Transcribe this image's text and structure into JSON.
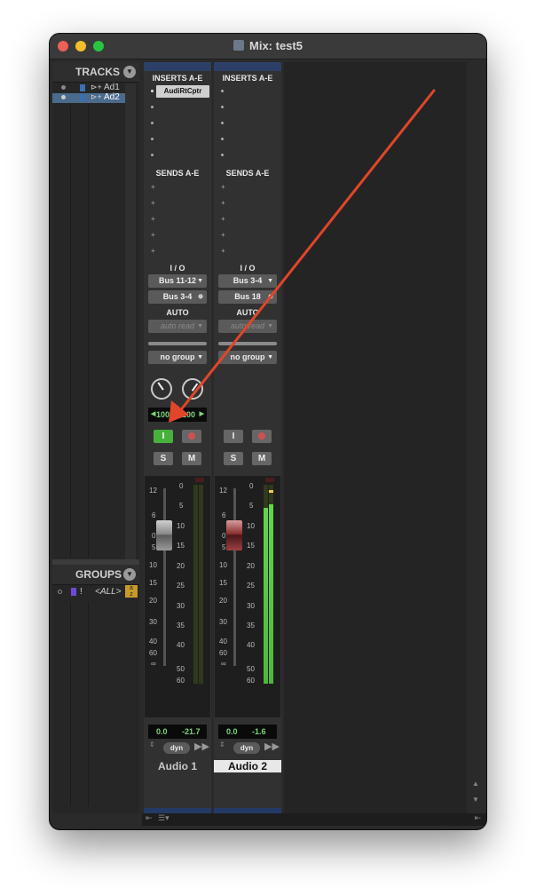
{
  "window": {
    "title": "Mix: test5"
  },
  "colors": {
    "accent_blue": "#3b6fb3",
    "record_red": "#d05050",
    "input_green": "#47b13b",
    "arrow_red": "#e0462a"
  },
  "tracks_panel": {
    "header": "TRACKS",
    "items": [
      {
        "label": "Ad1",
        "selected": false
      },
      {
        "label": "Ad2",
        "selected": true
      }
    ]
  },
  "groups_panel": {
    "header": "GROUPS",
    "items": [
      {
        "label": "<ALL>",
        "flag": "!"
      }
    ],
    "sort_icon": "a-z-sort-icon"
  },
  "strips": [
    {
      "inserts_header": "INSERTS A-E",
      "insert_plugin": "AudiRtCptr",
      "sends_header": "SENDS A-E",
      "io_header": "I / O",
      "input": "Bus 11-12",
      "output": "Bus 3-4",
      "auto_header": "AUTO",
      "auto_mode": "auto read",
      "group": "no group",
      "pan_left": "100",
      "pan_right": "100",
      "input_button": "I",
      "solo": "S",
      "mute": "M",
      "volume": "0.0",
      "peak": "-21.7",
      "dyn": "dyn",
      "name": "Audio 1",
      "name_selected": false
    },
    {
      "inserts_header": "INSERTS A-E",
      "sends_header": "SENDS A-E",
      "io_header": "I / O",
      "input": "Bus 3-4",
      "output": "Bus 18",
      "auto_header": "AUTO",
      "auto_mode": "auto read",
      "group": "no group",
      "input_button": "I",
      "solo": "S",
      "mute": "M",
      "volume": "0.0",
      "peak": "-1.6",
      "dyn": "dyn",
      "name": "Audio 2",
      "name_selected": true
    }
  ],
  "fader_scale": [
    "12",
    "6",
    "0",
    "5",
    "10",
    "15",
    "20",
    "30",
    "40",
    "60",
    "∞"
  ],
  "meter_scale": [
    "0",
    "5",
    "10",
    "15",
    "20",
    "25",
    "30",
    "35",
    "40",
    "50",
    "60"
  ]
}
